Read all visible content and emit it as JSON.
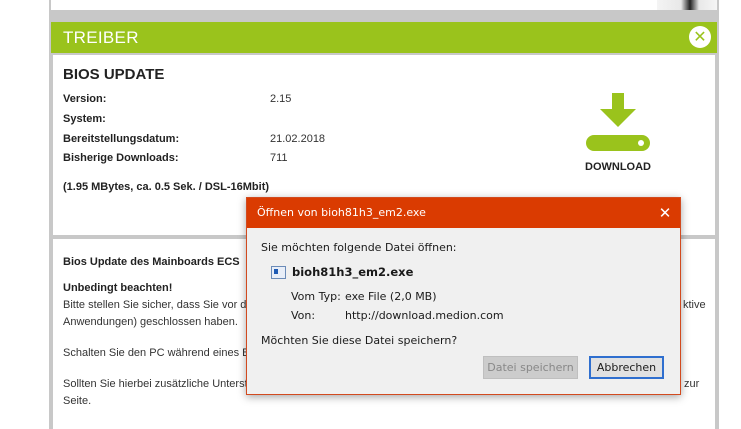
{
  "section": {
    "title": "TREIBER",
    "close_glyph": "✕"
  },
  "driver": {
    "title": "BIOS UPDATE",
    "rows": [
      {
        "label": "Version:",
        "value": "2.15"
      },
      {
        "label": "System:",
        "value": ""
      },
      {
        "label": "Bereitstellungsdatum:",
        "value": "21.02.2018"
      },
      {
        "label": "Bisherige Downloads:",
        "value": "711"
      }
    ],
    "size_note": "(1.95 MBytes, ca. 0.5 Sek. / DSL-16Mbit)",
    "download_label": "DOWNLOAD",
    "download_icon": "download-arrow-icon"
  },
  "description": {
    "title": "Bios Update des Mainboards ECS",
    "warning_title": "Unbedingt beachten!",
    "line1": "Bitte stellen Sie sicher, dass Sie vor d",
    "line1_tail": "ktive",
    "line2": "Anwendungen) geschlossen haben.",
    "line3": "Schalten Sie den PC während eines B",
    "line4": "Sollten Sie hierbei zusätzliche Unterst",
    "line4_tail": "zur",
    "line5": "Seite."
  },
  "dialog": {
    "title": "Öffnen von bioh81h3_em2.exe",
    "close_glyph": "✕",
    "prompt": "Sie möchten folgende Datei öffnen:",
    "file_name": "bioh81h3_em2.exe",
    "type_label": "Vom Typ:",
    "type_value": "exe File (2,0 MB)",
    "from_label": "Von:",
    "from_value": "http://download.medion.com",
    "question": "Möchten Sie diese Datei speichern?",
    "save_button": "Datei speichern",
    "cancel_button": "Abbrechen"
  },
  "colors": {
    "accent_green": "#9ac31c",
    "dialog_titlebar": "#da3b01",
    "focus_blue": "#2f6fcf"
  }
}
